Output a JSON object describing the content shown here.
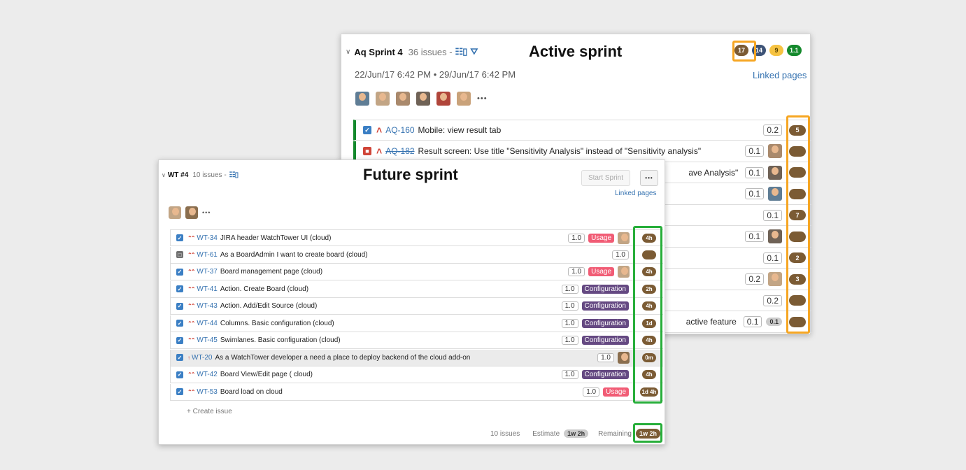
{
  "active": {
    "sprint_name": "Aq Sprint 4",
    "issue_count": "36 issues -",
    "board_icon": "☷▯",
    "filter_icon": "⛛",
    "caption": "Active sprint",
    "dates": "22/Jun/17 6:42 PM • 29/Jun/17 6:42 PM",
    "linked_pages": "Linked pages",
    "more": "•••",
    "badges": [
      {
        "value": "17",
        "color": "#7b5b34"
      },
      {
        "value": "14",
        "color": "#3d5377"
      },
      {
        "value": "9",
        "color": "#f6c342"
      },
      {
        "value": "1.1",
        "color": "#14892c"
      }
    ],
    "avatar_colors": [
      "#5f7d95",
      "#c2a585",
      "#a9896c",
      "#6f6256",
      "#b0453a",
      "#c9a27a"
    ],
    "rows": [
      {
        "key": "AQ-160",
        "summary": "Mobile: view result tab",
        "points": "0.2",
        "remaining": "5",
        "status": "done",
        "strike": false,
        "avatar": ""
      },
      {
        "key": "AQ-182",
        "summary": "Result screen: Use title \"Sensitivity Analysis\" instead of \"Sensitivity analysis\"",
        "points": "0.1",
        "remaining": "",
        "status": "bug",
        "strike": true,
        "avatar": "#a9896c"
      },
      {
        "key": "",
        "summary": "ave Analysis\"",
        "points": "0.1",
        "remaining": "",
        "status": "",
        "strike": false,
        "avatar": "#6f6256"
      },
      {
        "key": "",
        "summary": "",
        "points": "0.1",
        "remaining": "",
        "status": "",
        "strike": false,
        "avatar": "#5f7d95"
      },
      {
        "key": "",
        "summary": "",
        "points": "0.1",
        "remaining": "7",
        "status": "",
        "strike": false,
        "avatar": ""
      },
      {
        "key": "",
        "summary": "",
        "points": "0.1",
        "remaining": "",
        "status": "",
        "strike": false,
        "avatar": "#6f6256"
      },
      {
        "key": "",
        "summary": "",
        "points": "0.1",
        "remaining": "2",
        "status": "",
        "strike": false,
        "avatar": ""
      },
      {
        "key": "",
        "summary": "",
        "points": "0.2",
        "remaining": "3",
        "status": "",
        "strike": false,
        "avatar": "#c2a585"
      },
      {
        "key": "",
        "summary": "",
        "points": "0.2",
        "remaining": "",
        "status": "",
        "strike": false,
        "avatar": ""
      },
      {
        "key": "",
        "summary": "active feature",
        "points": "0.1",
        "remaining": "",
        "status": "",
        "strike": false,
        "avatar": "",
        "estimate": "0.1"
      }
    ]
  },
  "future": {
    "sprint_name": "WT #4",
    "issue_count": "10 issues -",
    "board_icon": "☷▯",
    "caption": "Future sprint",
    "start_sprint": "Start Sprint",
    "more": "•••",
    "linked_pages": "Linked pages",
    "avatar_colors": [
      "#c2a585",
      "#8a6e4e"
    ],
    "create_issue": "+ Create issue",
    "footer": {
      "issues": "10 issues",
      "estimate_label": "Estimate",
      "estimate_value": "1w 2h",
      "remaining_label": "Remaining",
      "remaining_value": "1w 2h"
    },
    "rows": [
      {
        "key": "WT-34",
        "summary": "JIRA header WatchTower UI (cloud)",
        "points": "1.0",
        "label": "Usage",
        "remaining": "4h",
        "status": "done",
        "prio": "⌃⌃",
        "avatar": "#c2a585"
      },
      {
        "key": "WT-61",
        "summary": "As a BoardAdmin I want to create board (cloud)",
        "points": "1.0",
        "label": "",
        "remaining": "",
        "status": "grey",
        "prio": "⌃⌃",
        "avatar": ""
      },
      {
        "key": "WT-37",
        "summary": "Board management page (cloud)",
        "points": "1.0",
        "label": "Usage",
        "remaining": "4h",
        "status": "done",
        "prio": "⌃⌃",
        "avatar": "#c2a585"
      },
      {
        "key": "WT-41",
        "summary": "Action. Create Board (cloud)",
        "points": "1.0",
        "label": "Configuration",
        "remaining": "2h",
        "status": "done",
        "prio": "⌃⌃",
        "avatar": ""
      },
      {
        "key": "WT-43",
        "summary": "Action. Add/Edit Source (cloud)",
        "points": "1.0",
        "label": "Configuration",
        "remaining": "4h",
        "status": "done",
        "prio": "⌃⌃",
        "avatar": ""
      },
      {
        "key": "WT-44",
        "summary": "Columns. Basic configuration (cloud)",
        "points": "1.0",
        "label": "Configuration",
        "remaining": "1d",
        "status": "done",
        "prio": "⌃⌃",
        "avatar": ""
      },
      {
        "key": "WT-45",
        "summary": "Swimlanes. Basic configuration (cloud)",
        "points": "1.0",
        "label": "Configuration",
        "remaining": "4h",
        "status": "done",
        "prio": "⌃⌃",
        "avatar": ""
      },
      {
        "key": "WT-20",
        "summary": "As a WatchTower developer a need a place to deploy backend of the cloud add-on",
        "points": "1.0",
        "label": "",
        "remaining": "0m",
        "status": "done",
        "prio": "↑",
        "avatar": "#8a6e4e",
        "highlight": true
      },
      {
        "key": "WT-42",
        "summary": "Board View/Edit page ( cloud)",
        "points": "1.0",
        "label": "Configuration",
        "remaining": "4h",
        "status": "done",
        "prio": "⌃⌃",
        "avatar": ""
      },
      {
        "key": "WT-53",
        "summary": "Board load on cloud",
        "points": "1.0",
        "label": "Usage",
        "remaining": "1d 4h",
        "status": "done",
        "prio": "⌃⌃",
        "avatar": ""
      }
    ]
  }
}
